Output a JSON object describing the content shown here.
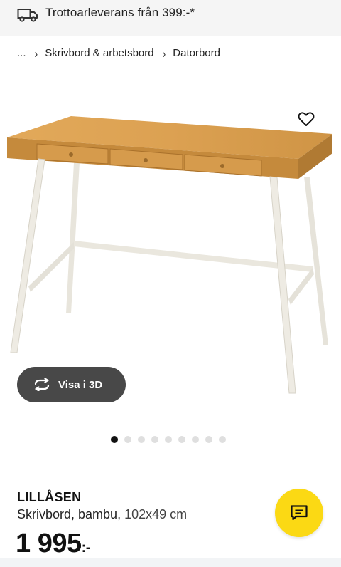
{
  "topbar": {
    "link_text": "Trottoarleverans från 399:-*",
    "icon": "truck-icon"
  },
  "breadcrumb": {
    "items": [
      "...",
      "Skrivbord & arbetsbord",
      "Datorbord"
    ]
  },
  "gallery": {
    "view3d_label": "Visa i 3D",
    "dots_total": 9,
    "active_dot": 1
  },
  "product": {
    "name": "LILLÅSEN",
    "description": "Skrivbord, bambu,",
    "dimensions": "102x49 cm",
    "price": "1 995",
    "price_suffix": ":-"
  },
  "colors": {
    "chat_button": "#fbd914",
    "view3d_button": "#484848",
    "active_dot": "#111111"
  }
}
